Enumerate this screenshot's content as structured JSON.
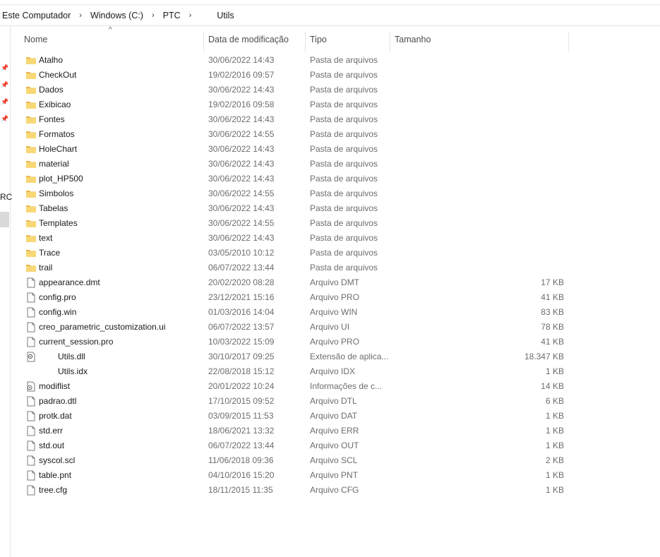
{
  "breadcrumb": [
    "Este Computador",
    "Windows (C:)",
    "PTC",
    "Utils"
  ],
  "breadcrumb_separator": "›",
  "left_pane": {
    "cut_label": "RC"
  },
  "columns": {
    "name": "Nome",
    "date": "Data de modificação",
    "type": "Tipo",
    "size": "Tamanho"
  },
  "sort_indicator": "^",
  "colors": {
    "folder": "#f8d775",
    "folder_dark": "#e8b74a",
    "text": "#1a1a1a",
    "muted": "#6d6d6d"
  },
  "files": [
    {
      "name": "Atalho",
      "date": "30/06/2022 14:43",
      "type": "Pasta de arquivos",
      "size": "",
      "icon": "folder-icon"
    },
    {
      "name": "CheckOut",
      "date": "19/02/2016 09:57",
      "type": "Pasta de arquivos",
      "size": "",
      "icon": "folder-icon"
    },
    {
      "name": "Dados",
      "date": "30/06/2022 14:43",
      "type": "Pasta de arquivos",
      "size": "",
      "icon": "folder-icon"
    },
    {
      "name": "Exibicao",
      "date": "19/02/2016 09:58",
      "type": "Pasta de arquivos",
      "size": "",
      "icon": "folder-icon"
    },
    {
      "name": "Fontes",
      "date": "30/06/2022 14:43",
      "type": "Pasta de arquivos",
      "size": "",
      "icon": "folder-icon"
    },
    {
      "name": "Formatos",
      "date": "30/06/2022 14:55",
      "type": "Pasta de arquivos",
      "size": "",
      "icon": "folder-icon"
    },
    {
      "name": "HoleChart",
      "date": "30/06/2022 14:43",
      "type": "Pasta de arquivos",
      "size": "",
      "icon": "folder-icon"
    },
    {
      "name": "material",
      "date": "30/06/2022 14:43",
      "type": "Pasta de arquivos",
      "size": "",
      "icon": "folder-icon"
    },
    {
      "name": "plot_HP500",
      "date": "30/06/2022 14:43",
      "type": "Pasta de arquivos",
      "size": "",
      "icon": "folder-icon"
    },
    {
      "name": "Simbolos",
      "date": "30/06/2022 14:55",
      "type": "Pasta de arquivos",
      "size": "",
      "icon": "folder-icon"
    },
    {
      "name": "Tabelas",
      "date": "30/06/2022 14:43",
      "type": "Pasta de arquivos",
      "size": "",
      "icon": "folder-icon"
    },
    {
      "name": "Templates",
      "date": "30/06/2022 14:55",
      "type": "Pasta de arquivos",
      "size": "",
      "icon": "folder-icon"
    },
    {
      "name": "text",
      "date": "30/06/2022 14:43",
      "type": "Pasta de arquivos",
      "size": "",
      "icon": "folder-icon"
    },
    {
      "name": "Trace",
      "date": "03/05/2010 10:12",
      "type": "Pasta de arquivos",
      "size": "",
      "icon": "folder-icon"
    },
    {
      "name": "trail",
      "date": "06/07/2022 13:44",
      "type": "Pasta de arquivos",
      "size": "",
      "icon": "folder-icon"
    },
    {
      "name": "appearance.dmt",
      "date": "20/02/2020 08:28",
      "type": "Arquivo DMT",
      "size": "17 KB",
      "icon": "file-icon"
    },
    {
      "name": "config.pro",
      "date": "23/12/2021 15:16",
      "type": "Arquivo PRO",
      "size": "41 KB",
      "icon": "file-icon"
    },
    {
      "name": "config.win",
      "date": "01/03/2016 14:04",
      "type": "Arquivo WIN",
      "size": "83 KB",
      "icon": "file-icon"
    },
    {
      "name": "creo_parametric_customization.ui",
      "date": "06/07/2022 13:57",
      "type": "Arquivo UI",
      "size": "78 KB",
      "icon": "file-icon"
    },
    {
      "name": "current_session.pro",
      "date": "10/03/2022 15:09",
      "type": "Arquivo PRO",
      "size": "41 KB",
      "icon": "file-icon"
    },
    {
      "name": "Utils.dll",
      "date": "30/10/2017 09:25",
      "type": "Extensão de aplica...",
      "size": "18.347 KB",
      "icon": "dll-icon",
      "indent": true
    },
    {
      "name": "Utils.idx",
      "date": "22/08/2018 15:12",
      "type": "Arquivo IDX",
      "size": "1 KB",
      "icon": "none",
      "indent": true
    },
    {
      "name": "modiflist",
      "date": "20/01/2022 10:24",
      "type": "Informações de c...",
      "size": "14 KB",
      "icon": "info-file-icon"
    },
    {
      "name": "padrao.dtl",
      "date": "17/10/2015 09:52",
      "type": "Arquivo DTL",
      "size": "6 KB",
      "icon": "file-icon"
    },
    {
      "name": "protk.dat",
      "date": "03/09/2015 11:53",
      "type": "Arquivo DAT",
      "size": "1 KB",
      "icon": "file-icon"
    },
    {
      "name": "std.err",
      "date": "18/06/2021 13:32",
      "type": "Arquivo ERR",
      "size": "1 KB",
      "icon": "file-icon"
    },
    {
      "name": "std.out",
      "date": "06/07/2022 13:44",
      "type": "Arquivo OUT",
      "size": "1 KB",
      "icon": "file-icon"
    },
    {
      "name": "syscol.scl",
      "date": "11/06/2018 09:36",
      "type": "Arquivo SCL",
      "size": "2 KB",
      "icon": "file-icon"
    },
    {
      "name": "table.pnt",
      "date": "04/10/2016 15:20",
      "type": "Arquivo PNT",
      "size": "1 KB",
      "icon": "file-icon"
    },
    {
      "name": "tree.cfg",
      "date": "18/11/2015 11:35",
      "type": "Arquivo CFG",
      "size": "1 KB",
      "icon": "file-icon"
    }
  ]
}
